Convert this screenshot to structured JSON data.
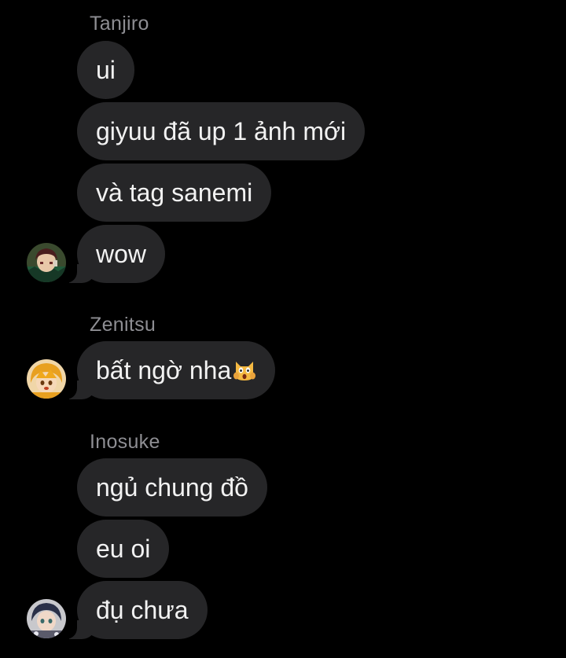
{
  "conversation": {
    "groups": [
      {
        "sender": "Tanjiro",
        "avatar": "tanjiro-avatar",
        "messages": [
          "ui",
          "giyuu đã up 1 ảnh mới",
          "và tag sanemi",
          "wow"
        ]
      },
      {
        "sender": "Zenitsu",
        "avatar": "zenitsu-avatar",
        "messages": [
          "bất ngờ nha"
        ],
        "emoji": "screaming-cat-emoji"
      },
      {
        "sender": "Inosuke",
        "avatar": "inosuke-avatar",
        "messages": [
          "ngủ chung đồ",
          "eu oi",
          "đụ chưa"
        ]
      }
    ]
  },
  "colors": {
    "background": "#000000",
    "bubble": "#262628",
    "sender_name": "#8e8e93",
    "message_text": "#f2f2f2"
  }
}
